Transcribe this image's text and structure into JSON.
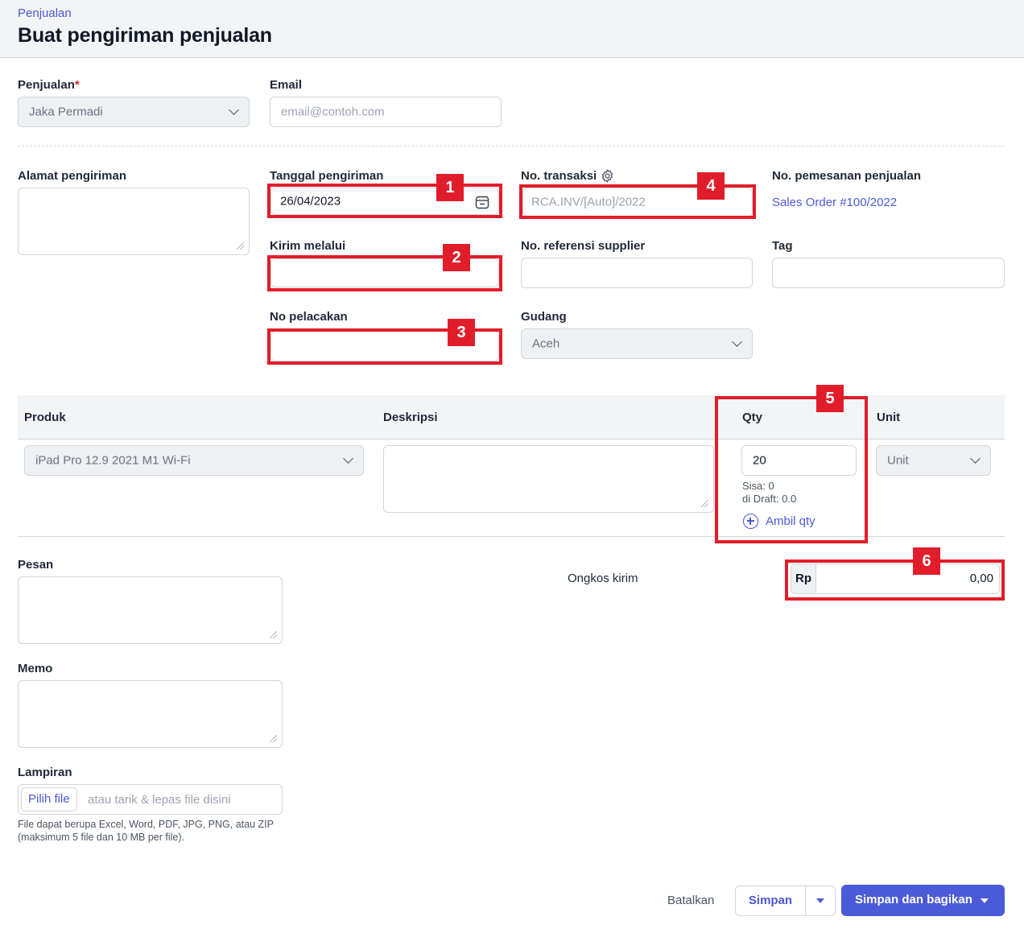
{
  "header": {
    "breadcrumb": "Penjualan",
    "title": "Buat pengiriman penjualan"
  },
  "penjualan": {
    "label": "Penjualan",
    "required_mark": "*",
    "value": "Jaka Permadi"
  },
  "email": {
    "label": "Email",
    "placeholder": "email@contoh.com"
  },
  "alamat": {
    "label": "Alamat pengiriman"
  },
  "tanggal": {
    "label": "Tanggal pengiriman",
    "value": "26/04/2023"
  },
  "no_transaksi": {
    "label": "No. transaksi",
    "placeholder": "RCA.INV/[Auto]/2022"
  },
  "no_pemesanan": {
    "label": "No. pemesanan penjualan",
    "link": "Sales Order #100/2022"
  },
  "kirim_melalui": {
    "label": "Kirim melalui"
  },
  "no_ref_supplier": {
    "label": "No. referensi supplier"
  },
  "tag": {
    "label": "Tag"
  },
  "no_pelacakan": {
    "label": "No pelacakan"
  },
  "gudang": {
    "label": "Gudang",
    "value": "Aceh"
  },
  "table": {
    "headers": {
      "produk": "Produk",
      "deskripsi": "Deskripsi",
      "qty": "Qty",
      "unit": "Unit"
    },
    "row": {
      "produk": "iPad Pro 12.9 2021 M1 Wi-Fi",
      "qty": "20",
      "sisa": "Sisa: 0",
      "di_draft": "di Draft: 0.0",
      "ambil_qty": "Ambil qty",
      "unit": "Unit"
    }
  },
  "pesan": {
    "label": "Pesan"
  },
  "ongkos": {
    "label": "Ongkos kirim",
    "currency": "Rp",
    "value": "0,00"
  },
  "memo": {
    "label": "Memo"
  },
  "lampiran": {
    "label": "Lampiran",
    "button": "Pilih file",
    "placeholder": "atau tarik & lepas file disini",
    "help_line1": "File dapat berupa Excel, Word, PDF, JPG, PNG, atau ZIP",
    "help_line2": "(maksimum 5 file dan 10 MB per file)."
  },
  "annotations": [
    "1",
    "2",
    "3",
    "4",
    "5",
    "6"
  ],
  "footer": {
    "cancel": "Batalkan",
    "save": "Simpan",
    "save_share": "Simpan dan bagikan"
  },
  "colors": {
    "accent": "#4b5ad6",
    "annotation_red": "#e21d2b",
    "header_bg": "#f3f4f6",
    "disabled_bg": "#eef0f3"
  }
}
